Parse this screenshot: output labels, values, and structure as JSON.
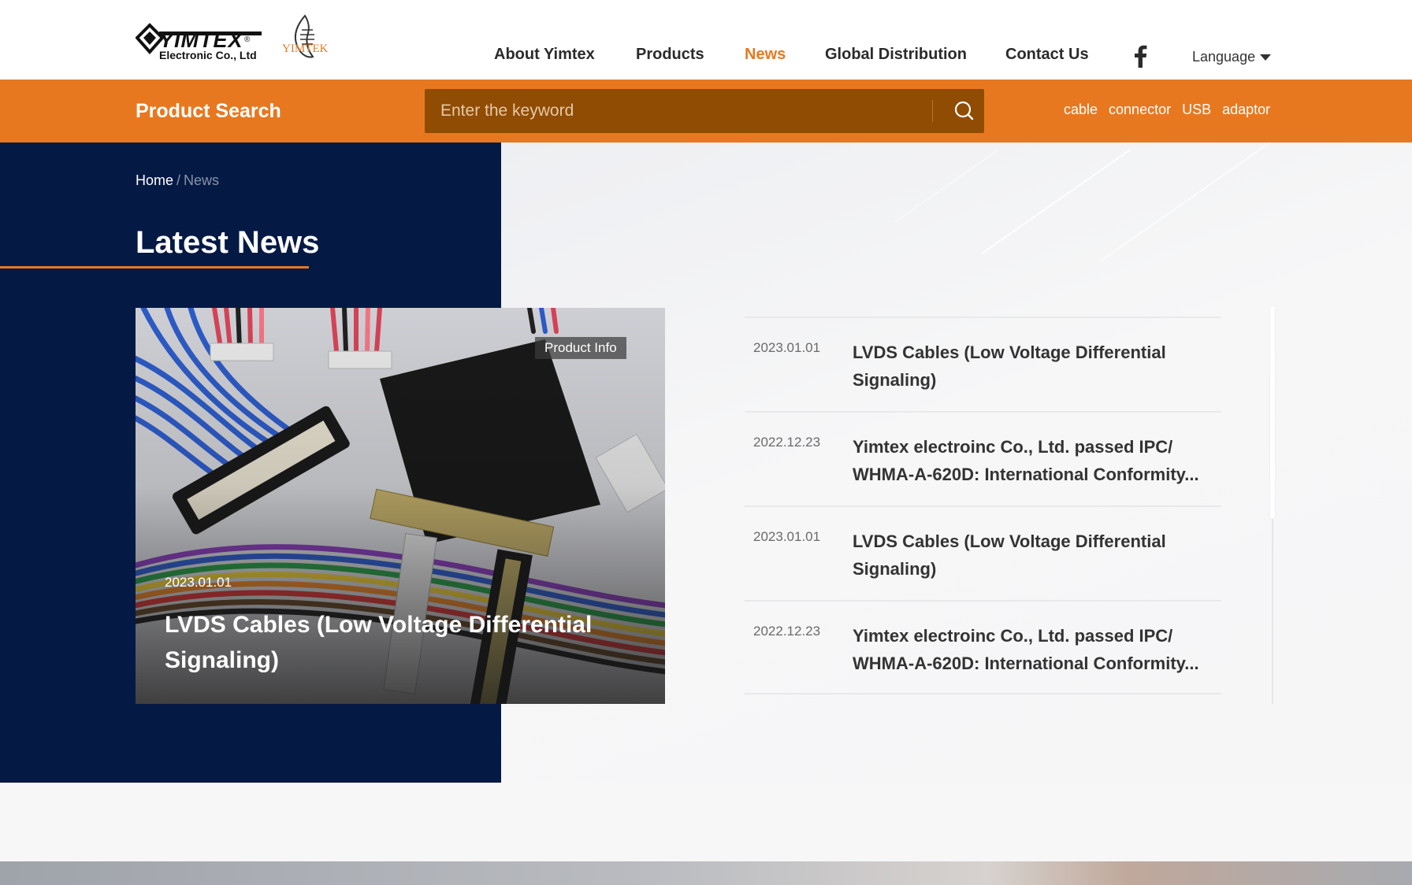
{
  "header": {
    "logo": {
      "brand": "YIMTEX",
      "subtitle": "Electronic Co., Ltd",
      "second_mark": "YIMTEK",
      "reg": "®"
    },
    "nav": [
      {
        "label": "About Yimtex",
        "active": false
      },
      {
        "label": "Products",
        "active": false
      },
      {
        "label": "News",
        "active": true
      },
      {
        "label": "Global Distribution",
        "active": false
      },
      {
        "label": "Contact Us",
        "active": false
      }
    ],
    "social_icon": "facebook-icon",
    "language_label": "Language"
  },
  "search": {
    "title": "Product Search",
    "placeholder": "Enter the keyword",
    "value": "",
    "button_icon": "search-icon",
    "tags": [
      "cable",
      "connector",
      "USB",
      "adaptor"
    ]
  },
  "breadcrumb": {
    "home": "Home",
    "separator": "/",
    "current": "News"
  },
  "page_title": "Latest News",
  "featured": {
    "badge": "Product Info",
    "date": "2023.01.01",
    "title": "LVDS Cables (Low Voltage Differential Signaling)"
  },
  "news": [
    {
      "date": "2023.01.01",
      "title": "LVDS Cables (Low Voltage Differential Signaling)"
    },
    {
      "date": "2022.12.23",
      "title": "Yimtex electroinc Co., Ltd. passed IPC/ WHMA-A-620D: International Conformity..."
    },
    {
      "date": "2023.01.01",
      "title": "LVDS Cables (Low Voltage Differential Signaling)"
    },
    {
      "date": "2022.12.23",
      "title": "Yimtex electroinc Co., Ltd. passed IPC/ WHMA-A-620D: International Conformity..."
    }
  ],
  "colors": {
    "accent": "#e8781f",
    "search_box": "#8f4c02",
    "navy": "#041a44",
    "background": "#f7f7f8"
  }
}
